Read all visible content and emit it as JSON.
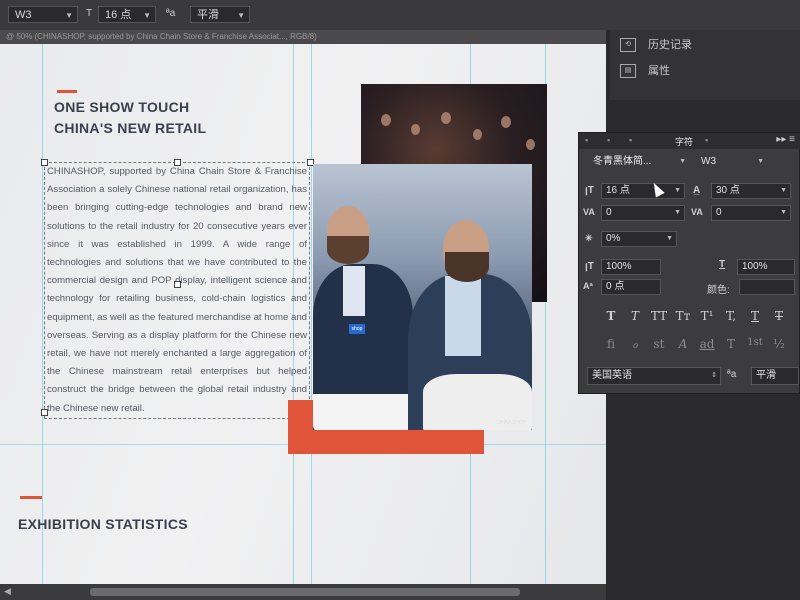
{
  "options_bar": {
    "font_style": "W3",
    "font_size": "16 点",
    "antialias": "平滑"
  },
  "doc_tab": {
    "text": "@ 50% (CHINASHOP, supported by China Chain Store & Franchise Associat..., RGB/8)"
  },
  "document": {
    "headline_line1": "ONE SHOW TOUCH",
    "headline_line2": "CHINA'S NEW RETAIL",
    "body": "CHINASHOP, supported by China Chain Store & Franchise Association a solely Chinese national retail organization, has been bringing cutting-edge technologies and brand new solutions to the retail industry for 20 consecutive years ever since it was established in 1999. A wide range of technologies and solutions that we have contributed to the commercial design and POP display, intelligent science and technology for retailing business, cold-chain logistics and equipment, as well as the featured merchandise at home and overseas. Serving as a display platform for the Chinese new retail, we have not merely enchanted a large aggregation of the Chinese mainstream retail enterprises but helped construct the bridge between the global retail industry and the Chinese new retail.",
    "section2_title": "EXHIBITION STATISTICS",
    "badge_text": "shop",
    "photo_watermark": "CHINASHOP"
  },
  "history_panel": {
    "items": [
      {
        "label": "历史记录"
      },
      {
        "label": "属性"
      }
    ]
  },
  "character_panel": {
    "tabs": [
      "字符"
    ],
    "font_family": "冬青黑体简...",
    "font_style": "W3",
    "font_size": "16 点",
    "leading": "30 点",
    "kerning": "0",
    "tracking": "0",
    "tsume": "0%",
    "vertical_scale": "100%",
    "horizontal_scale": "100%",
    "baseline_shift": "0 点",
    "color_label": "颜色:",
    "language": "美国英语",
    "aa_label": "ªa",
    "antialias": "平滑",
    "style_glyphs": [
      "T",
      "T",
      "TT",
      "Tт",
      "T¹",
      "T,",
      "T",
      "T"
    ],
    "opentype_glyphs": [
      "fi",
      "ℴ",
      "st",
      "A",
      "ad",
      "T",
      "1st",
      "½"
    ]
  },
  "colors": {
    "accent": "#e0553a",
    "heading": "#3a3f4f",
    "guide": "#49c8e6"
  }
}
